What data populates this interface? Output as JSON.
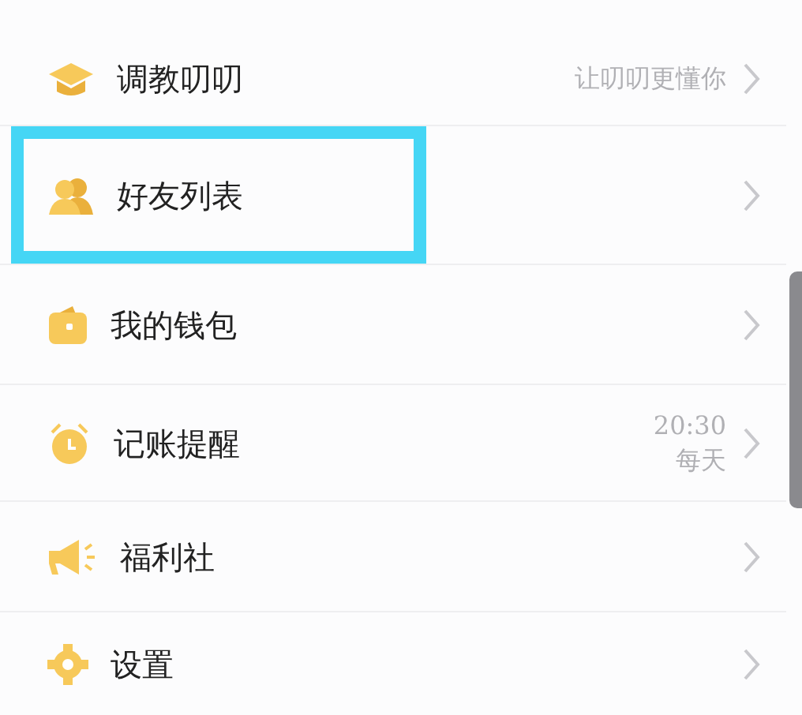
{
  "menu": [
    {
      "label": "调教叨叨",
      "value": [
        "让叨叨更懂你"
      ],
      "highlighted": false
    },
    {
      "label": "好友列表",
      "highlighted": true
    },
    {
      "label": "我的钱包",
      "highlighted": false
    },
    {
      "label": "记账提醒",
      "value": [
        "20:30",
        "每天"
      ],
      "highlighted": false
    },
    {
      "label": "福利社",
      "highlighted": false
    },
    {
      "label": "设置",
      "highlighted": false
    }
  ]
}
